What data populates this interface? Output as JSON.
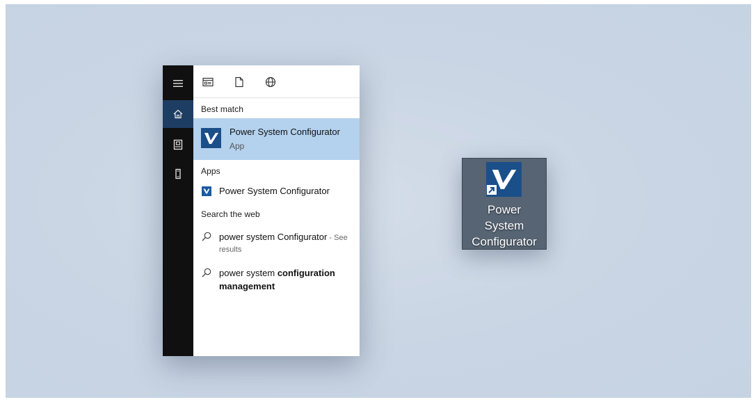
{
  "search_panel": {
    "sections": {
      "best_match": "Best match",
      "apps": "Apps",
      "search_web": "Search the web"
    },
    "best_match": {
      "title": "Power System Configurator",
      "subtitle": "App"
    },
    "apps": [
      {
        "label": "Power System Configurator"
      }
    ],
    "web_results": [
      {
        "query": "power system Configurator",
        "suffix": " - See",
        "detail": "results"
      },
      {
        "prefix": "power system ",
        "bold1": "configuration",
        "bold2": "management"
      }
    ],
    "rail_icons": [
      "menu-icon",
      "home-icon",
      "documents-icon",
      "device-icon"
    ],
    "filter_icons": [
      "apps-filter-icon",
      "document-filter-icon",
      "web-filter-icon"
    ]
  },
  "desktop_shortcut": {
    "line1": "Power",
    "line2": "System",
    "line3": "Configurator"
  },
  "colors": {
    "accent": "#1e3d63",
    "highlight": "#b4d2ee",
    "logo": "#1b4f8a",
    "desktop": "#c9d5e4"
  }
}
